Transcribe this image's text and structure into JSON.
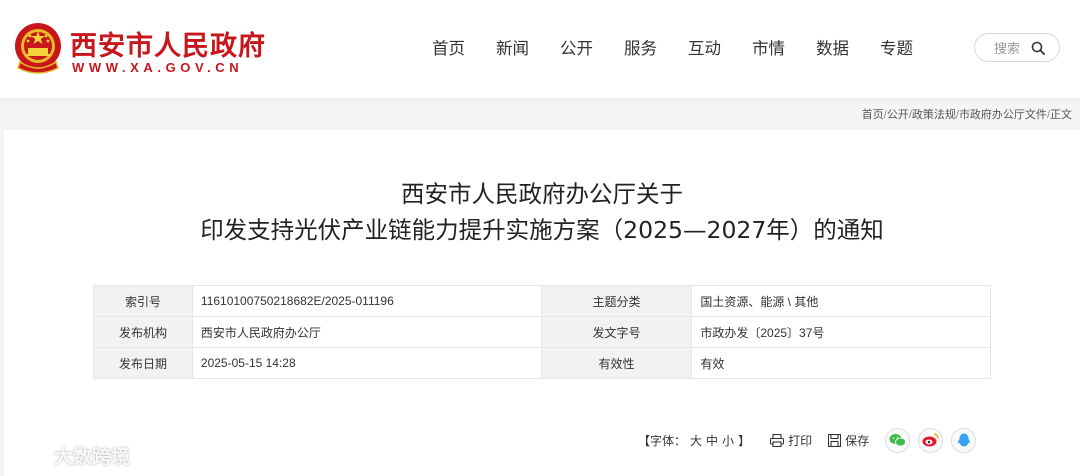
{
  "header": {
    "site_name": "西安市人民政府",
    "site_url": "WWW.XA.GOV.CN",
    "nav": [
      "首页",
      "新闻",
      "公开",
      "服务",
      "互动",
      "市情",
      "数据",
      "专题"
    ],
    "search_label": "搜索"
  },
  "breadcrumb": [
    "首页",
    "公开",
    "政策法规",
    "市政府办公厅文件",
    "正文"
  ],
  "article": {
    "title_line1": "西安市人民政府办公厅关于",
    "title_line2": "印发支持光伏产业链能力提升实施方案（2025—2027年）的通知"
  },
  "meta": {
    "rows": [
      [
        {
          "k": "索引号",
          "v": "11610100750218682E/2025-011196"
        },
        {
          "k": "主题分类",
          "v": "国土资源、能源 \\ 其他"
        }
      ],
      [
        {
          "k": "发布机构",
          "v": "西安市人民政府办公厅"
        },
        {
          "k": "发文字号",
          "v": "市政办发〔2025〕37号"
        }
      ],
      [
        {
          "k": "发布日期",
          "v": "2025-05-15 14:28"
        },
        {
          "k": "有效性",
          "v": "有效"
        }
      ]
    ]
  },
  "tools": {
    "font_label": "【字体：",
    "font_large": "大",
    "font_medium": "中",
    "font_small": "小",
    "font_close": "】",
    "print_label": "打印",
    "save_label": "保存"
  },
  "watermark": "大数跨境",
  "colors": {
    "brand_red": "#c8161d",
    "wechat": "#3fb94b",
    "weibo": "#e6162d",
    "qq": "#37a2f2"
  }
}
